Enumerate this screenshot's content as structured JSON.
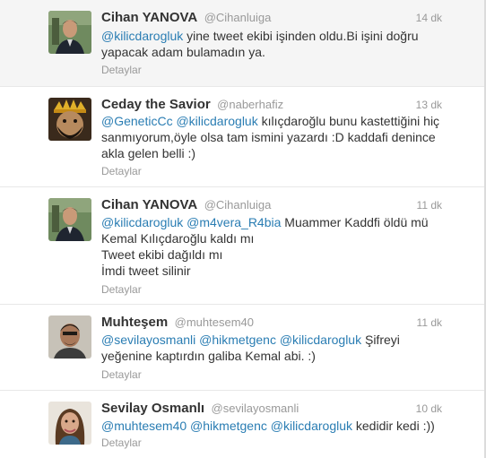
{
  "tweets": [
    {
      "name": "Cihan YANOVA",
      "username": "@Cihanluiga",
      "time": "14 dk",
      "details": "Detaylar",
      "lines": [
        [
          {
            "t": "@kilicdarogluk",
            "m": true
          },
          {
            "t": " yine tweet ekibi işinden oldu.Bi işini doğru"
          }
        ],
        [
          {
            "t": "yapacak adam bulamadın ya."
          }
        ]
      ]
    },
    {
      "name": "Ceday the Savior",
      "username": "@naberhafiz",
      "time": "13 dk",
      "details": "Detaylar",
      "lines": [
        [
          {
            "t": "@GeneticCc",
            "m": true
          },
          {
            "t": " "
          },
          {
            "t": "@kilicdarogluk",
            "m": true
          },
          {
            "t": " kılıçdaroğlu bunu kastettiğini hiç"
          }
        ],
        [
          {
            "t": "sanmıyorum,öyle olsa tam ismini yazardı :D kaddafi denince"
          }
        ],
        [
          {
            "t": "akla gelen belli :)"
          }
        ]
      ]
    },
    {
      "name": "Cihan YANOVA",
      "username": "@Cihanluiga",
      "time": "11 dk",
      "details": "Detaylar",
      "lines": [
        [
          {
            "t": "@kilicdarogluk",
            "m": true
          },
          {
            "t": " "
          },
          {
            "t": "@m4vera_R4bia",
            "m": true
          },
          {
            "t": " Muammer Kaddfi öldü mü"
          }
        ],
        [
          {
            "t": "Kemal Kılıçdaroğlu kaldı mı"
          }
        ],
        [
          {
            "t": "Tweet ekibi dağıldı mı"
          }
        ],
        [
          {
            "t": "İmdi tweet silinir"
          }
        ]
      ]
    },
    {
      "name": "Muhteşem",
      "username": "@muhtesem40",
      "time": "11 dk",
      "details": "Detaylar",
      "lines": [
        [
          {
            "t": "@sevilayosmanli",
            "m": true
          },
          {
            "t": " "
          },
          {
            "t": "@hikmetgenc",
            "m": true
          },
          {
            "t": " "
          },
          {
            "t": "@kilicdarogluk",
            "m": true
          },
          {
            "t": " Şifreyi"
          }
        ],
        [
          {
            "t": "yeğenine kaptırdın galiba Kemal abi. :)"
          }
        ]
      ]
    },
    {
      "name": "Sevilay Osmanlı",
      "username": "@sevilayosmanli",
      "time": "10 dk",
      "details": "Detaylar",
      "lines": [
        [
          {
            "t": "@muhtesem40",
            "m": true
          },
          {
            "t": " "
          },
          {
            "t": "@hikmetgenc",
            "m": true
          },
          {
            "t": " "
          },
          {
            "t": "@kilicdarogluk",
            "m": true
          },
          {
            "t": " kedidir kedi :))"
          }
        ]
      ]
    }
  ],
  "colors": {
    "mention": "#2a7db3",
    "meta": "#999999",
    "text": "#333333",
    "hover_bg": "#f5f5f5"
  }
}
